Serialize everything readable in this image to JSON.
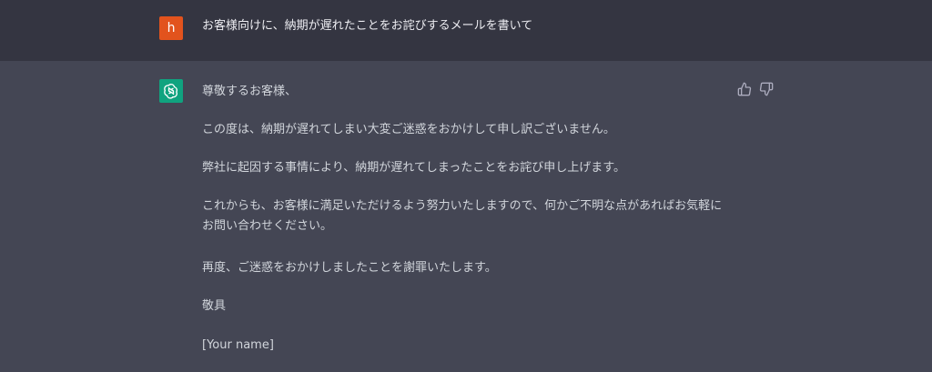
{
  "user_message": {
    "avatar_letter": "h",
    "text": "お客様向けに、納期が遅れたことをお詫びするメールを書いて"
  },
  "assistant_message": {
    "paragraphs": [
      "尊敬するお客様、",
      "この度は、納期が遅れてしまい大変ご迷惑をおかけして申し訳ございません。",
      "弊社に起因する事情により、納期が遅れてしまったことをお詫び申し上げます。",
      "これからも、お客様に満足いただけるよう努力いたしますので、何かご不明な点があればお気軽にお問い合わせください。",
      "再度、ご迷惑をおかけしましたことを謝罪いたします。",
      "敬具",
      "[Your name]"
    ]
  },
  "icons": {
    "thumbs_up": "thumbs-up-icon",
    "thumbs_down": "thumbs-down-icon",
    "assistant_logo": "openai-logo-icon"
  },
  "colors": {
    "user_bg": "#343541",
    "assistant_bg": "#444654",
    "user_avatar": "#e2531d",
    "assistant_avatar": "#10a37f"
  }
}
